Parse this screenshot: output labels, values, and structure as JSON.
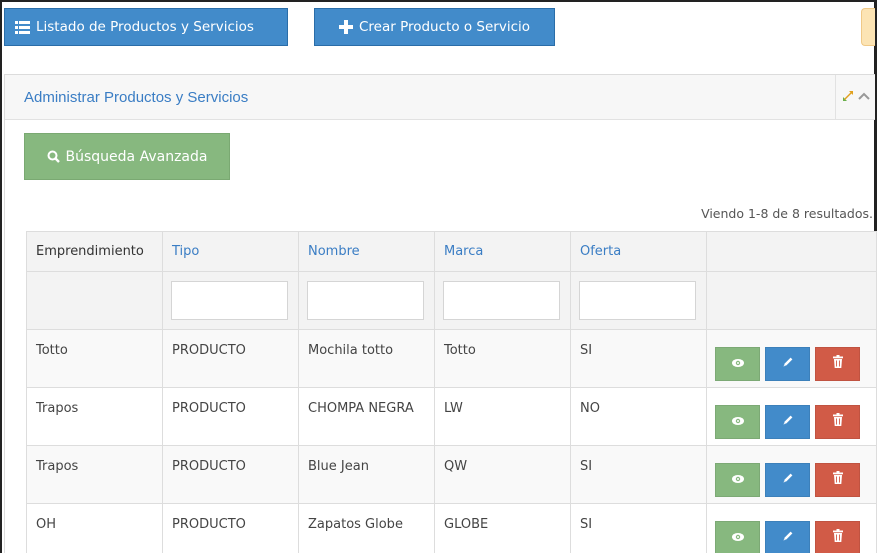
{
  "toolbar": {
    "list_label": "Listado de Productos y Servicios",
    "create_label": "Crear Producto o Servicio"
  },
  "panel": {
    "title": "Administrar Productos y Servicios",
    "search_label": "Búsqueda Avanzada",
    "summary": "Viendo 1-8 de 8 resultados."
  },
  "table": {
    "columns": [
      "Emprendimiento",
      "Tipo",
      "Nombre",
      "Marca",
      "Oferta"
    ],
    "rows": [
      [
        "Totto",
        "PRODUCTO",
        "Mochila totto",
        "Totto",
        "SI"
      ],
      [
        "Trapos",
        "PRODUCTO",
        "CHOMPA NEGRA",
        "LW",
        "NO"
      ],
      [
        "Trapos",
        "PRODUCTO",
        "Blue Jean",
        "QW",
        "SI"
      ],
      [
        "OH",
        "PRODUCTO",
        "Zapatos Globe",
        "GLOBE",
        "SI"
      ]
    ]
  },
  "icons": {
    "list": "list-icon",
    "create": "plus-icon",
    "search": "search-icon",
    "expand": "expand-icon",
    "collapse": "chevron-up-icon",
    "view": "eye-icon",
    "edit": "pencil-icon",
    "delete": "trash-icon"
  },
  "colors": {
    "primary": "#428bca",
    "success": "#87b87f",
    "danger": "#d15b47",
    "title": "#3a7dc4"
  }
}
